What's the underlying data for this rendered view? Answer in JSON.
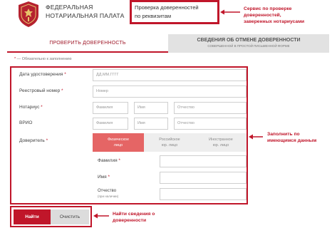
{
  "header": {
    "org_line1": "ФЕДЕРАЛЬНАЯ",
    "org_line2": "НОТАРИАЛЬНАЯ ПАЛАТА",
    "search_label_line1": "Проверка доверенностей",
    "search_label_line2": "по реквизитам"
  },
  "annotations": {
    "service_line1": "Сервис по проверке",
    "service_line2": "доверенностей,",
    "service_line3": "заверенных нотариусами",
    "fill_line1": "Заполнить по",
    "fill_line2": "имеющимся данным",
    "find_line1": "Найти сведения о",
    "find_line2": "доверенности"
  },
  "tabs": {
    "active_label": "ПРОВЕРИТЬ ДОВЕРЕННОСТЬ",
    "inactive_label": "СВЕДЕНИЯ ОБ ОТМЕНЕ ДОВЕРЕННОСТИ",
    "inactive_sublabel": "СОВЕРШЕННОЙ В ПРОСТОЙ ПИСЬМЕННОЙ ФОРМЕ"
  },
  "required_note": "— Обязательно к заполнению",
  "form": {
    "date_label": "Дата удостоверения",
    "date_placeholder": "ДД.ММ.ГГГГ",
    "reg_label": "Реестровый номер",
    "reg_placeholder": "Номер",
    "notary_label": "Нотариус",
    "vrio_label": "ВРИО",
    "surname_placeholder": "Фамилия",
    "name_placeholder": "Имя",
    "patronymic_placeholder": "Отчество",
    "principal_label": "Доверитель",
    "principal_types": [
      {
        "line1": "Физическое",
        "line2": "лицо"
      },
      {
        "line1": "Российское",
        "line2": "юр. лицо"
      },
      {
        "line1": "Иностранное",
        "line2": "юр. лицо"
      }
    ],
    "principal_surname_label": "Фамилия",
    "principal_name_label": "Имя",
    "principal_patronymic_label": "Отчество",
    "principal_patronymic_sub": "(при наличии)",
    "star": "*"
  },
  "buttons": {
    "find": "Найти",
    "clear": "Очистить"
  },
  "colors": {
    "accent": "#c0162a",
    "segment_active": "#e56565",
    "tab_inactive_bg": "#e2e2e2",
    "button_clear_bg": "#dcdcdc"
  }
}
